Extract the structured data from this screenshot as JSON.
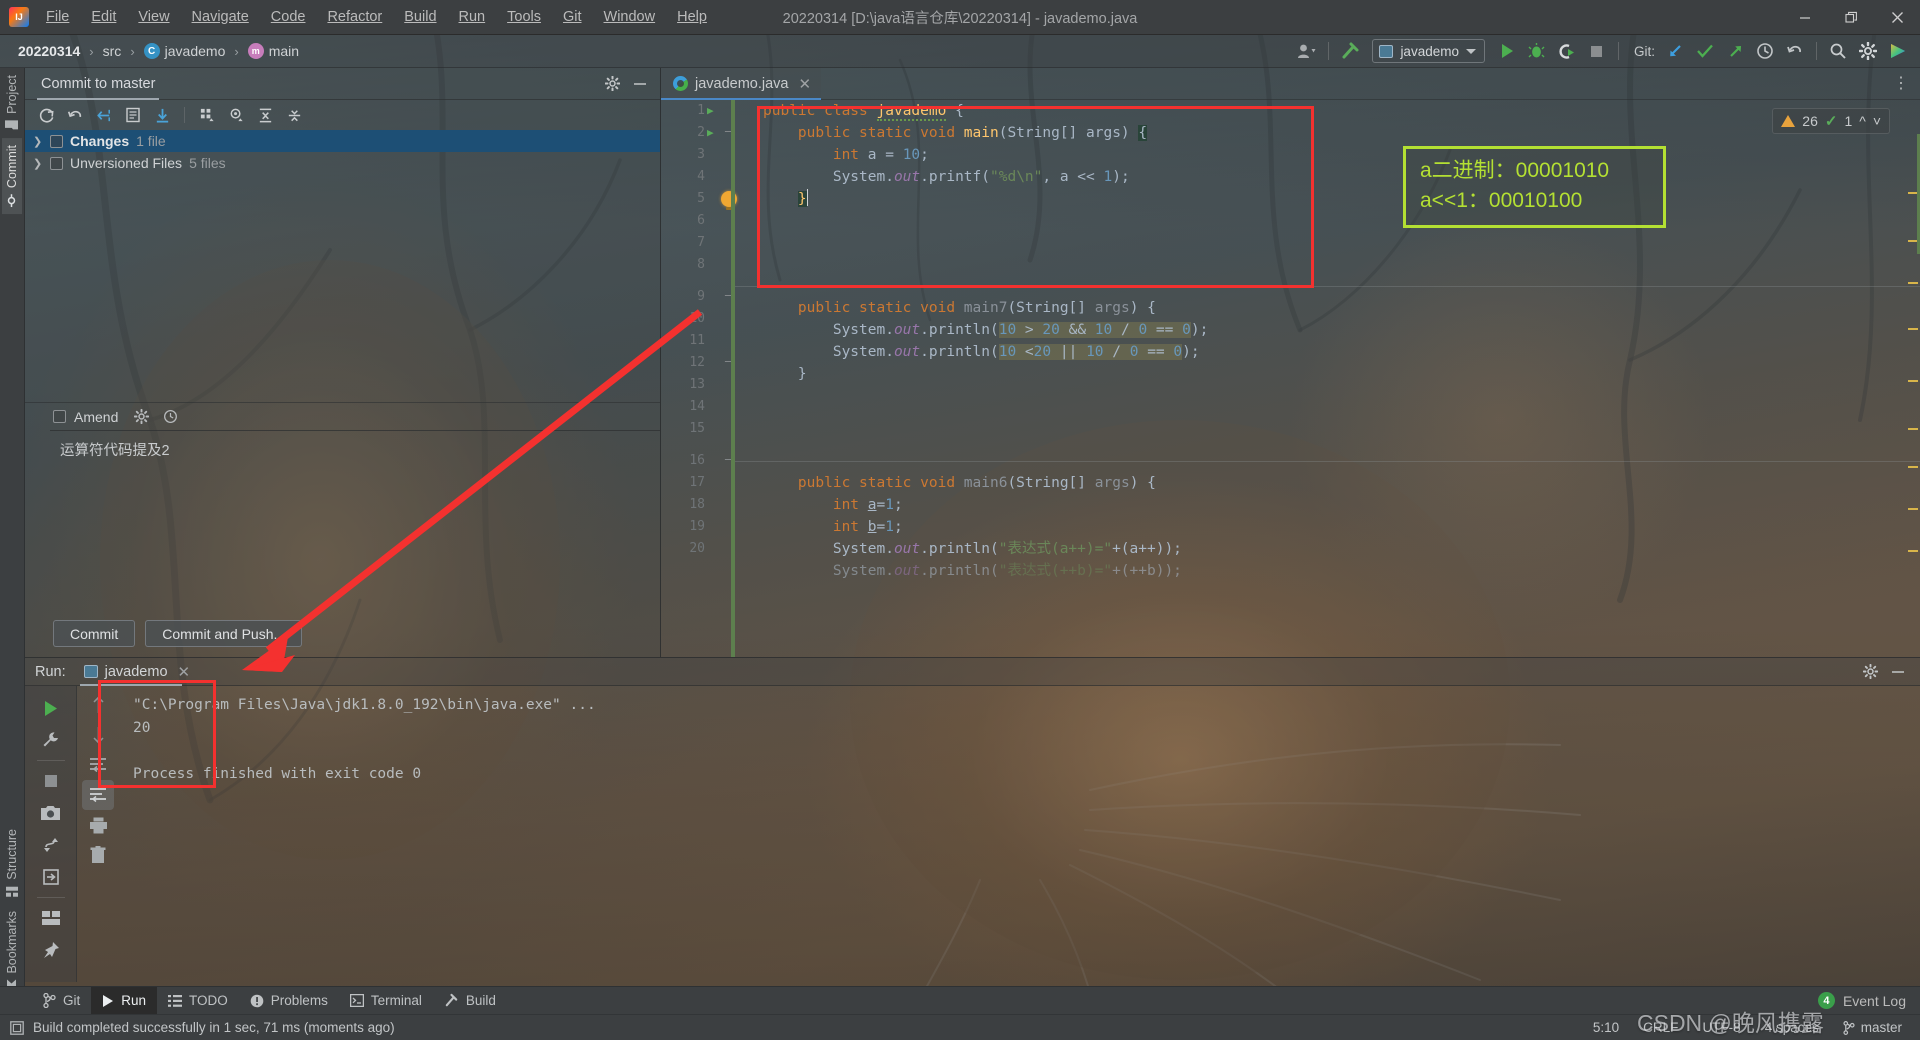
{
  "window": {
    "title": "20220314 [D:\\java语言仓库\\20220314] - javademo.java",
    "minimize": "minimize-icon",
    "restore": "restore-icon",
    "close": "close-icon"
  },
  "menubar": {
    "items": [
      {
        "label": "File"
      },
      {
        "label": "Edit"
      },
      {
        "label": "View"
      },
      {
        "label": "Navigate"
      },
      {
        "label": "Code"
      },
      {
        "label": "Refactor"
      },
      {
        "label": "Build"
      },
      {
        "label": "Run"
      },
      {
        "label": "Tools"
      },
      {
        "label": "Git"
      },
      {
        "label": "Window"
      },
      {
        "label": "Help"
      }
    ]
  },
  "navbar": {
    "breadcrumbs": [
      {
        "label": "20220314",
        "icon": ""
      },
      {
        "label": "src",
        "icon": ""
      },
      {
        "label": "javademo",
        "icon": "class-icon"
      },
      {
        "label": "main",
        "icon": "method-icon"
      }
    ],
    "separator": "›",
    "run_config": "javademo",
    "git_label": "Git:",
    "icons": [
      "user-avatar-icon",
      "build-hammer-icon",
      "run-icon",
      "debug-icon",
      "run-coverage-icon",
      "stop-icon",
      "git-update-icon",
      "git-commit-icon",
      "git-push-icon",
      "history-icon",
      "undo-icon",
      "search-everywhere-icon",
      "settings-gear-icon",
      "plugin-icon"
    ]
  },
  "left_strip": {
    "tabs": [
      {
        "label": "Project",
        "icon": "project-folder-icon",
        "active": false
      },
      {
        "label": "Commit",
        "icon": "commit-icon",
        "active": true
      },
      {
        "label": "Structure",
        "icon": "structure-icon",
        "active": false
      },
      {
        "label": "Bookmarks",
        "icon": "bookmark-icon",
        "active": false
      }
    ]
  },
  "commit_window": {
    "tab_label": "Commit to master",
    "header_icons": [
      "settings-gear-icon",
      "hide-icon"
    ],
    "toolbar_icons": [
      "refresh-icon",
      "rollback-icon",
      "shelve-silently-icon",
      "diff-icon",
      "update-icon",
      "group-by-icon",
      "preview-icon",
      "expand-all-icon",
      "collapse-all-icon"
    ],
    "tree": [
      {
        "label": "Changes",
        "count": "1 file",
        "selected": true,
        "expanded": false
      },
      {
        "label": "Unversioned Files",
        "count": "5 files",
        "selected": false,
        "expanded": false
      }
    ],
    "amend_label": "Amend",
    "amend_icons": [
      "settings-gear-icon",
      "history-icon"
    ],
    "commit_message": "运算符代码提及2",
    "buttons": [
      {
        "label": "Commit"
      },
      {
        "label": "Commit and Push..."
      }
    ]
  },
  "editor": {
    "tab": {
      "label": "javademo.java",
      "icon": "java-class-icon",
      "close": "close-icon"
    },
    "inspection": {
      "warning_count": "26",
      "warning_icon": "warning-triangle-icon",
      "ok_count": "1",
      "ok_icon": "inspection-ok-icon",
      "prev_icon": "chevron-up-icon",
      "next_icon": "chevron-down-icon"
    },
    "more_icon": "more-vertical-icon",
    "lines": [
      {
        "n": "1",
        "text": "public class javademo {"
      },
      {
        "n": "2",
        "text": "    public static void main(String[] args) {"
      },
      {
        "n": "3",
        "text": "        int a = 10;"
      },
      {
        "n": "4",
        "text": "        System.out.printf(\"%d\\n\", a << 1);"
      },
      {
        "n": "5",
        "text": "    }"
      },
      {
        "n": "6",
        "text": ""
      },
      {
        "n": "7",
        "text": ""
      },
      {
        "n": "8",
        "text": ""
      },
      {
        "n": "9",
        "text": "    public static void main7(String[] args) {"
      },
      {
        "n": "10",
        "text": "        System.out.println(10 > 20 && 10 / 0 == 0);"
      },
      {
        "n": "11",
        "text": "        System.out.println(10 <20 || 10 / 0 == 0);"
      },
      {
        "n": "12",
        "text": "    }"
      },
      {
        "n": "13",
        "text": ""
      },
      {
        "n": "14",
        "text": ""
      },
      {
        "n": "15",
        "text": ""
      },
      {
        "n": "16",
        "text": "    public static void main6(String[] args) {"
      },
      {
        "n": "17",
        "text": "        int a=1;"
      },
      {
        "n": "18",
        "text": "        int b=1;"
      },
      {
        "n": "19",
        "text": "        System.out.println(\"表达式(a++)=\"+(a++));"
      },
      {
        "n": "20",
        "text": "        System.out.println(\"表达式(++b)=\"+(++b));"
      }
    ]
  },
  "annotations": {
    "note": {
      "line1": "a二进制：00001010",
      "line2": "a<<1：00010100",
      "color": "#b4e033"
    },
    "red_color": "#f4312f",
    "arrow": "red-arrow-annotation"
  },
  "run_window": {
    "label": "Run:",
    "tab": {
      "label": "javademo",
      "icon": "run-config-icon",
      "close": "close-icon"
    },
    "header_icons": [
      "settings-gear-icon",
      "hide-icon"
    ],
    "side_icons": [
      "rerun-icon",
      "wrench-icon",
      "stop-icon",
      "screenshot-icon",
      "thread-dump-icon",
      "export-icon",
      "layout-icon",
      "pin-icon"
    ],
    "side2_icons": [
      "up-arrow-icon",
      "down-arrow-icon",
      "soft-wrap-icon",
      "scroll-to-end-icon",
      "print-icon",
      "trash-icon"
    ],
    "console": [
      {
        "text": "\"C:\\Program Files\\Java\\jdk1.8.0_192\\bin\\java.exe\" ...",
        "style": "cmd"
      },
      {
        "text": "20",
        "style": "out"
      },
      {
        "text": "",
        "style": "out"
      },
      {
        "text": "Process finished with exit code 0",
        "style": "out"
      }
    ]
  },
  "status_tabs": {
    "items": [
      {
        "label": "Git",
        "icon": "git-branch-icon",
        "active": false
      },
      {
        "label": "Run",
        "icon": "run-icon",
        "active": true
      },
      {
        "label": "TODO",
        "icon": "todo-list-icon",
        "active": false
      },
      {
        "label": "Problems",
        "icon": "problems-icon",
        "active": false
      },
      {
        "label": "Terminal",
        "icon": "terminal-icon",
        "active": false
      },
      {
        "label": "Build",
        "icon": "build-hammer-icon",
        "active": false
      }
    ],
    "event_log": {
      "label": "Event Log",
      "count": "4"
    }
  },
  "statusbar": {
    "message": "Build completed successfully in 1 sec, 71 ms (moments ago)",
    "message_icon": "build-status-icon",
    "caret": "5:10",
    "line_sep": "CRLF",
    "encoding": "UTF-8",
    "indent": "4 spaces",
    "branch": "master",
    "branch_icon": "git-branch-icon"
  },
  "watermark": {
    "text": "CSDN @晚风携露"
  }
}
